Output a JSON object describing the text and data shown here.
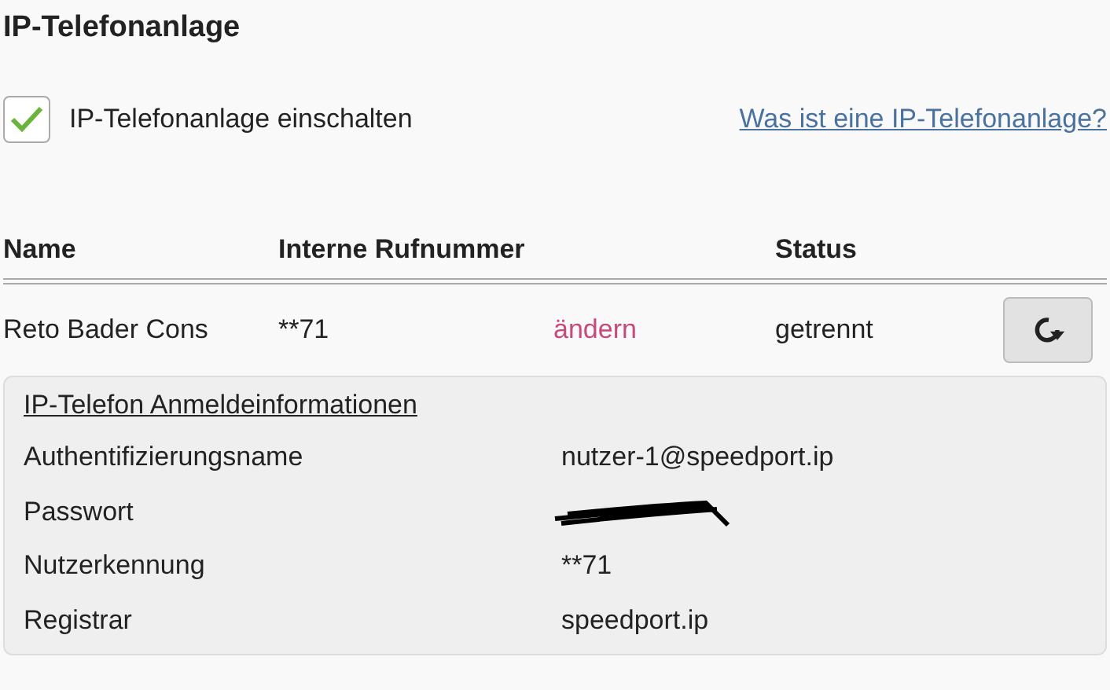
{
  "title": "IP-Telefonanlage",
  "enable": {
    "label": "IP-Telefonanlage einschalten",
    "checked": true
  },
  "help_link": "Was ist eine IP-Telefonanlage?",
  "table": {
    "columns": [
      "Name",
      "Interne Rufnummer",
      "Status"
    ],
    "rows": [
      {
        "name": "Reto Bader Cons",
        "number": "**71",
        "action": "ändern",
        "status": "getrennt"
      }
    ]
  },
  "details": {
    "title": "IP-Telefon Anmeldeinformationen",
    "fields": [
      {
        "label": "Authentifizierungsname",
        "value": "nutzer-1@speedport.ip"
      },
      {
        "label": "Passwort",
        "kind": "redacted"
      },
      {
        "label": "Nutzerkennung",
        "value": "**71"
      },
      {
        "label": "Registrar",
        "value": "speedport.ip"
      }
    ]
  }
}
